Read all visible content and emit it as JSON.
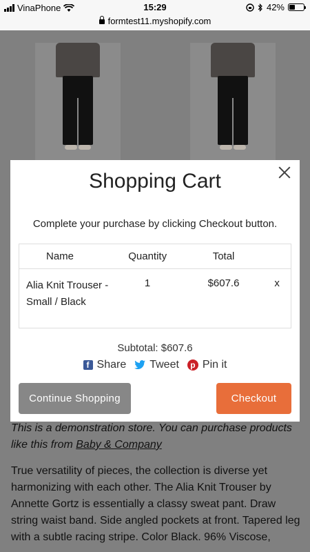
{
  "status_bar": {
    "carrier": "VinaPhone",
    "time": "15:29",
    "battery": "42%"
  },
  "url_bar": {
    "url": "formtest11.myshopify.com"
  },
  "page": {
    "demo_note_prefix": "This is a demonstration store. You can purchase products like this from ",
    "demo_link": "Baby & Company",
    "description": "True versatility of pieces, the collection is diverse yet harmonizing with each other. The Alia Knit Trouser by Annette Gortz is essentially a classy sweat pant. Draw string waist band. Side angled pockets at front. Tapered leg with a subtle racing stripe. Color Black. 96% Viscose,"
  },
  "cart": {
    "title": "Shopping Cart",
    "description": "Complete your purchase by clicking Checkout button.",
    "columns": {
      "name": "Name",
      "quantity": "Quantity",
      "total": "Total"
    },
    "items": [
      {
        "name": "Alia Knit Trouser - Small / Black",
        "quantity": "1",
        "total": "$607.6",
        "remove": "x"
      }
    ],
    "subtotal": "Subtotal: $607.6",
    "share": {
      "facebook": "Share",
      "twitter": "Tweet",
      "pinterest": "Pin it"
    },
    "continue_label": "Continue Shopping",
    "checkout_label": "Checkout"
  },
  "colors": {
    "checkout": "#e86e3a",
    "continue": "#878787",
    "facebook": "#3b5998",
    "twitter": "#1da1f2",
    "pinterest": "#cb2027"
  }
}
